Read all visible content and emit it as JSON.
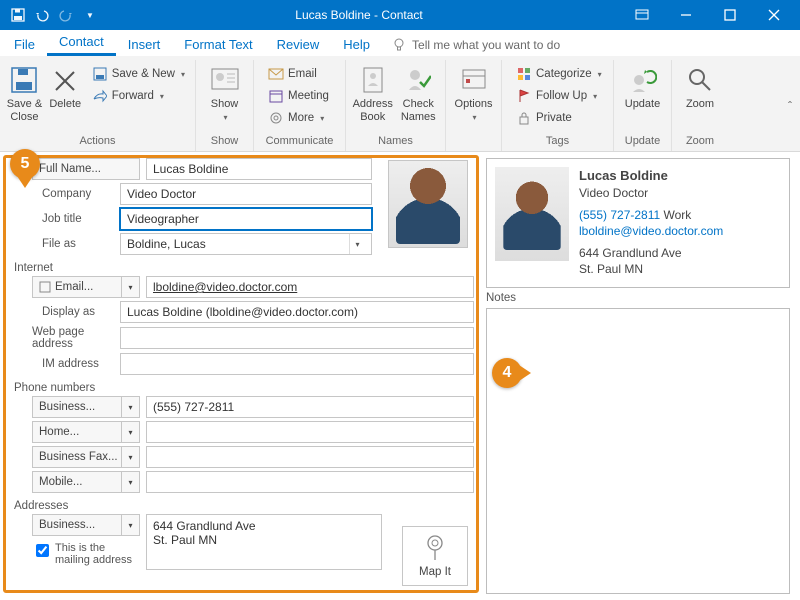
{
  "titlebar": {
    "title": "Lucas Boldine  -  Contact"
  },
  "tabs": [
    "File",
    "Contact",
    "Insert",
    "Format Text",
    "Review",
    "Help"
  ],
  "tell_me": "Tell me what you want to do",
  "ribbon": {
    "actions": {
      "label": "Actions",
      "save_close": "Save &\nClose",
      "delete": "Delete",
      "save_new": "Save & New",
      "forward": "Forward"
    },
    "show": {
      "label": "Show",
      "show": "Show"
    },
    "communicate": {
      "label": "Communicate",
      "email": "Email",
      "meeting": "Meeting",
      "more": "More"
    },
    "names": {
      "label": "Names",
      "address_book": "Address\nBook",
      "check_names": "Check\nNames"
    },
    "options": {
      "label": "",
      "options": "Options"
    },
    "tags": {
      "label": "Tags",
      "categorize": "Categorize",
      "follow_up": "Follow Up",
      "private": "Private"
    },
    "update": {
      "label": "Update",
      "update": "Update"
    },
    "zoom": {
      "label": "Zoom",
      "zoom": "Zoom"
    }
  },
  "form": {
    "full_name_btn": "Full Name...",
    "full_name_val": "Lucas Boldine",
    "company_lbl": "Company",
    "company_val": "Video Doctor",
    "job_title_lbl": "Job title",
    "job_title_val": "Videographer",
    "file_as_lbl": "File as",
    "file_as_val": "Boldine, Lucas",
    "internet_hdr": "Internet",
    "email_btn": "Email...",
    "email_val": "lboldine@video.doctor.com",
    "display_as_lbl": "Display as",
    "display_as_val": "Lucas Boldine (lboldine@video.doctor.com)",
    "web_lbl": "Web page address",
    "web_val": "",
    "im_lbl": "IM address",
    "im_val": "",
    "phone_hdr": "Phone numbers",
    "phone_business_btn": "Business...",
    "phone_business_val": "(555) 727-2811",
    "phone_home_btn": "Home...",
    "phone_bfax_btn": "Business Fax...",
    "phone_mobile_btn": "Mobile...",
    "addresses_hdr": "Addresses",
    "addr_business_btn": "Business...",
    "addr_val": "644 Grandlund Ave\nSt. Paul MN",
    "mailing_chk": "This is the mailing address",
    "map_it": "Map It"
  },
  "card": {
    "name": "Lucas Boldine",
    "company": "Video Doctor",
    "phone": "(555) 727-2811",
    "phone_type": "Work",
    "email": "lboldine@video.doctor.com",
    "addr1": "644 Grandlund Ave",
    "addr2": "St. Paul MN"
  },
  "notes_lbl": "Notes",
  "callouts": {
    "c4": "4",
    "c5": "5"
  }
}
